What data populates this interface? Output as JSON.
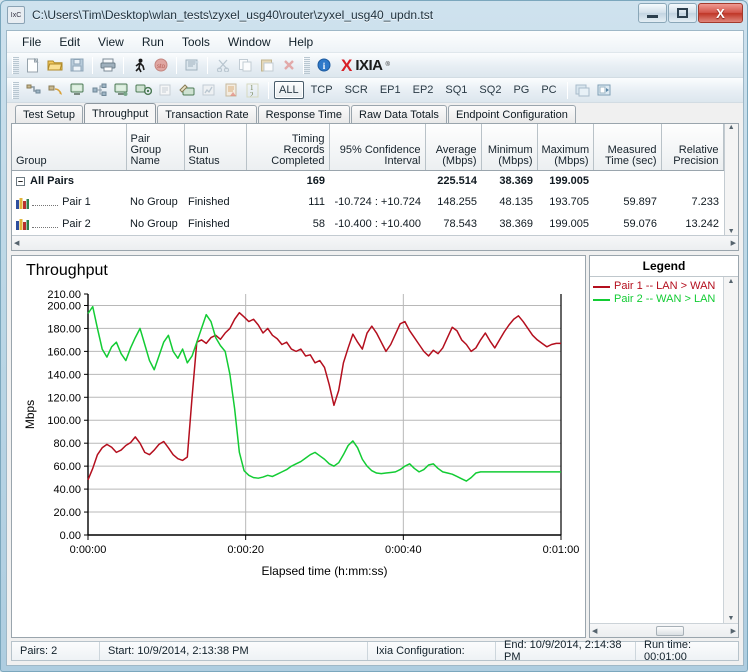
{
  "window": {
    "title": "C:\\Users\\Tim\\Desktop\\wlan_tests\\zyxel_usg40\\router\\zyxel_usg40_updn.tst",
    "app_icon_text": "IxC",
    "minimize_label": "Minimize",
    "maximize_label": "Maximize",
    "close_label": "X"
  },
  "menu": [
    "File",
    "Edit",
    "View",
    "Run",
    "Tools",
    "Window",
    "Help"
  ],
  "toolbar_filters": [
    "ALL",
    "TCP",
    "SCR",
    "EP1",
    "EP2",
    "SQ1",
    "SQ2",
    "PG",
    "PC"
  ],
  "toolbar_filters_active": "ALL",
  "brand": {
    "x": "X",
    "name": "IXIA",
    "reg": "®"
  },
  "tabs": [
    {
      "label": "Test Setup",
      "active": false
    },
    {
      "label": "Throughput",
      "active": true
    },
    {
      "label": "Transaction Rate",
      "active": false
    },
    {
      "label": "Response Time",
      "active": false
    },
    {
      "label": "Raw Data Totals",
      "active": false
    },
    {
      "label": "Endpoint Configuration",
      "active": false
    }
  ],
  "table": {
    "headers": [
      "Group",
      "Pair Group\nName",
      "Run Status",
      "Timing Records\nCompleted",
      "95% Confidence\nInterval",
      "Average\n(Mbps)",
      "Minimum\n(Mbps)",
      "Maximum\n(Mbps)",
      "Measured\nTime (sec)",
      "Relative\nPrecision"
    ],
    "rows": [
      {
        "group": "All Pairs",
        "pair_group_name": "",
        "run_status": "",
        "timing_records": "169",
        "confidence_interval": "",
        "average": "225.514",
        "minimum": "38.369",
        "maximum": "199.005",
        "measured_time": "",
        "relative_precision": "",
        "is_summary": true
      },
      {
        "group": "Pair 1",
        "pair_group_name": "No Group",
        "run_status": "Finished",
        "timing_records": "111",
        "confidence_interval": "-10.724 : +10.724",
        "average": "148.255",
        "minimum": "48.135",
        "maximum": "193.705",
        "measured_time": "59.897",
        "relative_precision": "7.233",
        "is_summary": false
      },
      {
        "group": "Pair 2",
        "pair_group_name": "No Group",
        "run_status": "Finished",
        "timing_records": "58",
        "confidence_interval": "-10.400 : +10.400",
        "average": "78.543",
        "minimum": "38.369",
        "maximum": "199.005",
        "measured_time": "59.076",
        "relative_precision": "13.242",
        "is_summary": false
      }
    ]
  },
  "legend": {
    "title": "Legend",
    "items": [
      {
        "label": "Pair 1 -- LAN > WAN",
        "color": "#b40f1e"
      },
      {
        "label": "Pair 2 -- WAN > LAN",
        "color": "#13cc34"
      }
    ]
  },
  "statusbar": {
    "pairs": "Pairs: 2",
    "start": "Start: 10/9/2014, 2:13:38 PM",
    "configuration": "Ixia Configuration:",
    "end": "End: 10/9/2014, 2:14:38 PM",
    "runtime": "Run time: 00:01:00"
  },
  "chart_data": {
    "type": "line",
    "title": "Throughput",
    "xlabel": "Elapsed time (h:mm:ss)",
    "ylabel": "Mbps",
    "ylim": [
      0,
      210
    ],
    "ytick_step": 20,
    "yticks": [
      "0.00",
      "20.00",
      "40.00",
      "60.00",
      "80.00",
      "100.00",
      "120.00",
      "140.00",
      "160.00",
      "180.00",
      "200.00",
      "210.00"
    ],
    "xticks": [
      "0:00:00",
      "0:00:20",
      "0:00:40",
      "0:01:00"
    ],
    "xlim": [
      0,
      60
    ],
    "grid": true,
    "legend_position": "right-panel",
    "series": [
      {
        "name": "Pair 1 -- LAN > WAN",
        "color": "#b40f1e",
        "x": [
          0,
          0.6,
          1.2,
          1.8,
          2.4,
          3.0,
          3.6,
          4.2,
          4.8,
          5.4,
          6.0,
          6.6,
          7.2,
          7.8,
          8.4,
          9.0,
          9.6,
          10.2,
          10.8,
          11.4,
          12.0,
          12.6,
          13.2,
          13.8,
          14.4,
          15.0,
          15.6,
          16.2,
          16.8,
          17.4,
          18.0,
          18.6,
          19.2,
          19.8,
          20.4,
          21.0,
          21.6,
          22.2,
          22.8,
          23.4,
          24.0,
          24.6,
          25.2,
          25.8,
          26.4,
          27.0,
          27.6,
          28.2,
          28.8,
          29.4,
          30.0,
          30.6,
          31.2,
          31.8,
          32.4,
          33.0,
          33.6,
          34.2,
          34.8,
          35.4,
          36.0,
          36.6,
          37.2,
          37.8,
          38.4,
          39.0,
          39.6,
          40.2,
          40.8,
          41.4,
          42.0,
          42.6,
          43.2,
          43.8,
          44.4,
          45.0,
          45.6,
          46.2,
          46.8,
          47.4,
          48.0,
          48.6,
          49.2,
          49.8,
          50.4,
          51.0,
          51.6,
          52.2,
          52.8,
          53.4,
          54.0,
          54.6,
          55.2,
          55.8,
          56.4,
          57.0,
          57.6,
          58.2,
          58.8,
          59.4,
          60.0
        ],
        "y": [
          48.1,
          58.0,
          70.0,
          76.0,
          79.0,
          76.5,
          72.0,
          74.0,
          78.0,
          80.5,
          85.5,
          80.0,
          72.0,
          70.0,
          74.0,
          79.0,
          81.5,
          76.0,
          70.0,
          66.5,
          65.0,
          68.0,
          120.0,
          168.0,
          170.0,
          167.0,
          172.0,
          174.0,
          170.5,
          176.0,
          180.0,
          188.0,
          193.7,
          190.0,
          186.0,
          188.0,
          183.0,
          176.0,
          180.0,
          174.0,
          171.0,
          166.0,
          168.0,
          162.0,
          160.0,
          162.0,
          156.0,
          157.0,
          150.0,
          152.0,
          146.0,
          131.0,
          113.0,
          126.0,
          150.0,
          163.0,
          175.0,
          168.0,
          162.0,
          176.0,
          182.0,
          176.0,
          168.0,
          160.0,
          166.0,
          175.0,
          184.0,
          186.0,
          178.0,
          172.0,
          166.0,
          160.0,
          156.0,
          161.0,
          158.0,
          163.0,
          172.0,
          181.0,
          178.0,
          170.0,
          166.0,
          160.0,
          163.0,
          170.0,
          176.0,
          169.0,
          163.0,
          170.0,
          177.0,
          183.0,
          188.0,
          191.0,
          186.0,
          180.0,
          174.0,
          170.0,
          167.0,
          164.0,
          166.0,
          167.0,
          167.0
        ]
      },
      {
        "name": "Pair 2 -- WAN > LAN",
        "color": "#13cc34",
        "x": [
          0,
          0.6,
          1.2,
          1.8,
          2.4,
          3.0,
          3.6,
          4.2,
          4.8,
          5.4,
          6.0,
          6.6,
          7.2,
          7.8,
          8.4,
          9.0,
          9.6,
          10.2,
          10.8,
          11.4,
          12.0,
          12.6,
          13.2,
          13.8,
          14.4,
          15.0,
          15.6,
          16.2,
          16.8,
          17.4,
          18.0,
          18.6,
          19.2,
          19.8,
          20.4,
          21.0,
          21.6,
          22.2,
          22.8,
          23.4,
          24.0,
          24.6,
          25.2,
          25.8,
          26.4,
          27.0,
          27.6,
          28.2,
          28.8,
          29.4,
          30.0,
          30.6,
          31.2,
          31.8,
          32.4,
          33.0,
          33.6,
          34.2,
          34.8,
          35.4,
          36.0,
          36.6,
          37.2,
          37.8,
          38.4,
          39.0,
          39.6,
          40.2,
          40.8,
          41.4,
          42.0,
          42.6,
          43.2,
          43.8,
          44.4,
          45.0,
          45.6,
          46.2,
          46.8,
          47.4,
          48.0,
          48.6,
          49.2,
          49.8,
          50.4,
          51.0,
          51.6,
          52.2,
          52.8,
          53.4,
          54.0,
          54.6,
          55.2,
          55.8,
          56.4,
          57.0,
          57.6,
          58.2,
          58.8,
          59.4,
          60.0
        ],
        "y": [
          193.0,
          199.0,
          180.0,
          162.0,
          155.0,
          164.0,
          168.0,
          158.0,
          152.0,
          163.0,
          172.0,
          180.0,
          166.0,
          152.0,
          144.0,
          156.0,
          168.0,
          174.0,
          160.0,
          154.0,
          162.0,
          150.0,
          156.0,
          168.0,
          180.0,
          192.0,
          186.0,
          172.0,
          165.0,
          160.0,
          140.0,
          110.0,
          72.0,
          56.0,
          52.0,
          50.0,
          49.5,
          50.5,
          52.0,
          51.0,
          53.0,
          55.0,
          57.0,
          60.0,
          62.0,
          64.0,
          67.0,
          70.0,
          72.0,
          69.0,
          66.0,
          62.0,
          60.0,
          63.0,
          70.0,
          78.0,
          82.0,
          76.0,
          66.0,
          60.0,
          56.0,
          54.0,
          53.5,
          54.0,
          54.5,
          55.0,
          57.0,
          60.0,
          62.0,
          58.0,
          55.0,
          57.0,
          61.0,
          62.0,
          58.0,
          55.0,
          54.0,
          53.0,
          51.0,
          49.0,
          47.0,
          50.0,
          54.0,
          55.0,
          55.0,
          55.0,
          55.0,
          55.0,
          55.0,
          55.0,
          55.0,
          55.0,
          55.0,
          55.0,
          55.0,
          55.0,
          55.0,
          55.0,
          55.0,
          55.0,
          55.0
        ]
      }
    ]
  }
}
